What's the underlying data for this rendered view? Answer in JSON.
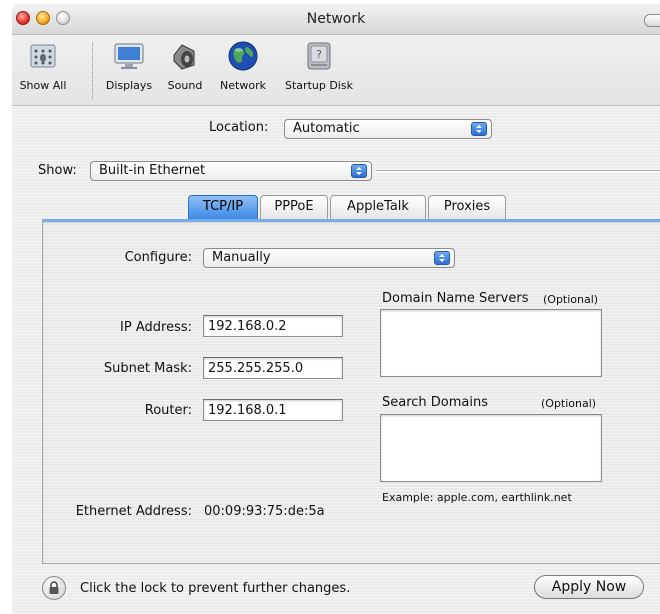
{
  "window": {
    "title": "Network"
  },
  "toolbar": {
    "items": [
      {
        "label": "Show All",
        "icon": "show-all-icon"
      },
      {
        "label": "Displays",
        "icon": "display-icon"
      },
      {
        "label": "Sound",
        "icon": "speaker-icon"
      },
      {
        "label": "Network",
        "icon": "globe-icon"
      },
      {
        "label": "Startup Disk",
        "icon": "disk-icon"
      }
    ]
  },
  "location": {
    "label": "Location:",
    "value": "Automatic"
  },
  "show": {
    "label": "Show:",
    "value": "Built-in Ethernet"
  },
  "tabs": [
    {
      "label": "TCP/IP",
      "active": true
    },
    {
      "label": "PPPoE",
      "active": false
    },
    {
      "label": "AppleTalk",
      "active": false
    },
    {
      "label": "Proxies",
      "active": false
    }
  ],
  "tcpip": {
    "configure_label": "Configure:",
    "configure_value": "Manually",
    "ip_label": "IP Address:",
    "ip_value": "192.168.0.2",
    "subnet_label": "Subnet Mask:",
    "subnet_value": "255.255.255.0",
    "router_label": "Router:",
    "router_value": "192.168.0.1",
    "dns_label": "Domain Name Servers",
    "dns_optional": "(Optional)",
    "dns_value": "",
    "search_label": "Search Domains",
    "search_optional": "(Optional)",
    "search_value": "",
    "example": "Example: apple.com, earthlink.net",
    "ethernet_label": "Ethernet Address:",
    "ethernet_value": "00:09:93:75:de:5a"
  },
  "footer": {
    "lock_text": "Click the lock to prevent further changes.",
    "apply_label": "Apply Now"
  },
  "colors": {
    "accent": "#3d87e3",
    "panel_border": "#78aee8"
  }
}
